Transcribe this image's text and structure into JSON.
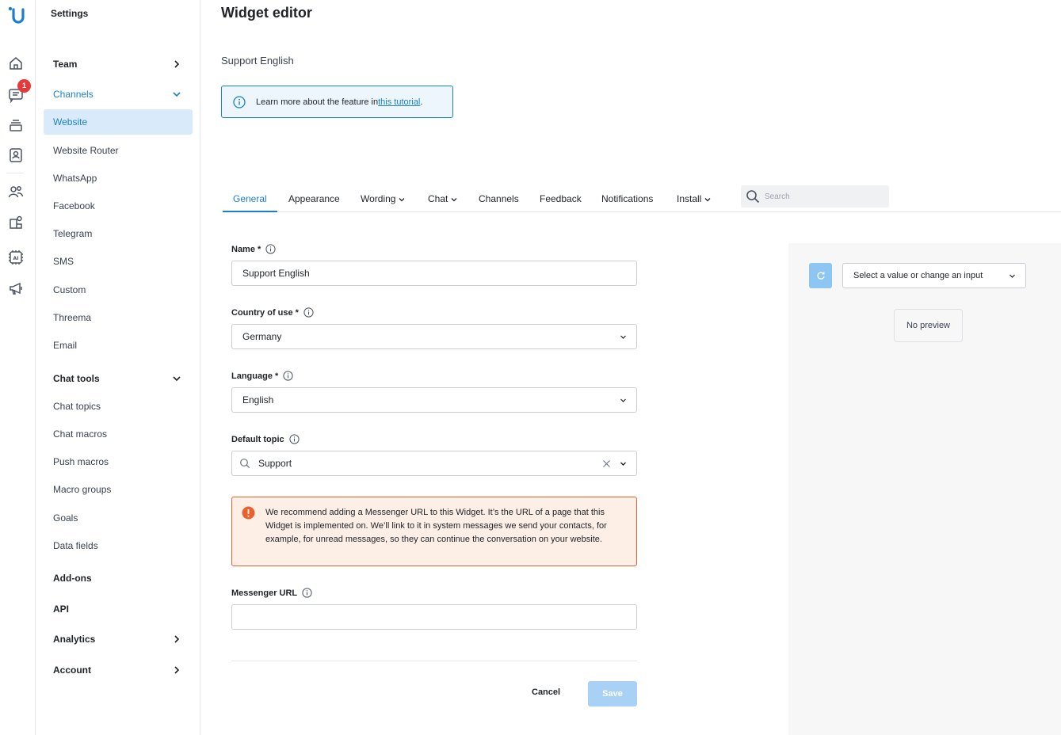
{
  "app": {
    "badge_count": "1",
    "brand_color": "#1b7fd1"
  },
  "rail": {
    "icons": [
      "logo-icon",
      "home-icon",
      "chat-icon",
      "layers-icon",
      "contacts-icon",
      "team-icon",
      "integrations-icon",
      "ai-icon",
      "megaphone-icon"
    ]
  },
  "sidebar": {
    "title": "Settings",
    "team": "Team",
    "channels": "Channels",
    "channel_items": [
      "Website",
      "Website Router",
      "WhatsApp",
      "Facebook",
      "Telegram",
      "SMS",
      "Custom",
      "Threema",
      "Email"
    ],
    "chat_tools": "Chat tools",
    "chat_tools_items": [
      "Chat topics",
      "Chat macros",
      "Push macros",
      "Macro groups",
      "Goals",
      "Data fields"
    ],
    "addons": "Add-ons",
    "api": "API",
    "analytics": "Analytics",
    "account": "Account"
  },
  "main": {
    "title": "Widget editor",
    "subtitle": "Support English",
    "info_text": "Learn more about the feature in ",
    "info_link": "this tutorial",
    "info_end": "."
  },
  "tabs": {
    "items": [
      "General",
      "Appearance",
      "Wording",
      "Chat",
      "Channels",
      "Feedback",
      "Notifications",
      "Install"
    ],
    "search_placeholder": "Search"
  },
  "form": {
    "name_label": "Name *",
    "name_value": "Support English",
    "country_label": "Country of use *",
    "country_value": "Germany",
    "language_label": "Language *",
    "language_value": "English",
    "topic_label": "Default topic",
    "topic_value": "Support",
    "warning": "We recommend adding a Messenger URL to this Widget. It’s the URL of a page that this Widget is implemented on. We’ll link to it in system messages we send your contacts, for example, for unread messages, so they can continue the conversation on your website.",
    "messenger_label": "Messenger URL",
    "messenger_value": "",
    "cancel": "Cancel",
    "save": "Save"
  },
  "preview": {
    "select_value": "Select a value or change an input",
    "no_preview": "No preview"
  }
}
